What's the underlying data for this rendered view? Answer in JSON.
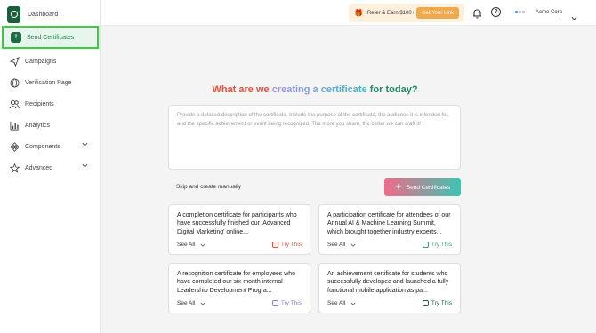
{
  "sidebar": {
    "brand_label": "Dashboard",
    "items": [
      {
        "label": "Send Certificates",
        "icon": "plus-icon",
        "active": true
      },
      {
        "label": "Campaigns",
        "icon": "send-icon"
      },
      {
        "label": "Verification Page",
        "icon": "globe-icon"
      },
      {
        "label": "Recipients",
        "icon": "users-icon"
      },
      {
        "label": "Analytics",
        "icon": "bar-chart-icon"
      },
      {
        "label": "Components",
        "icon": "components-icon",
        "expandable": true
      },
      {
        "label": "Advanced",
        "icon": "star-icon",
        "expandable": true
      }
    ]
  },
  "topbar": {
    "refer_label": "Refer & Earn $100+",
    "get_link_label": "Get Your Link",
    "account_name": "Acme Corp"
  },
  "main": {
    "headline": {
      "part1": "What are we ",
      "highlight": "creating a certificate",
      "part2": " for today?"
    },
    "prompt_placeholder": "Provide a detailed description of the certificate. Include the purpose of the certificate, the audience it is intended for, and the specific achievement or event being recognized. The more you share, the better we can craft it!",
    "skip_label": "Skip and create manually",
    "send_label": "Send Certificates",
    "cards": [
      {
        "text": "A completion certificate for participants who have successfully finished our 'Advanced Digital Marketing' online...",
        "see_all": "See All",
        "try_label": "Try This",
        "color": "#e0533d"
      },
      {
        "text": "A participation certificate for attendees of our Annual AI & Machine Learning Summit, which brought together industry experts...",
        "see_all": "See All",
        "try_label": "Try This",
        "color": "#3aa86b"
      },
      {
        "text": "A recognition certificate for employees who have completed our six-month internal Leadership Development Progra...",
        "see_all": "See All",
        "try_label": "Try This",
        "color": "#8a7fe0"
      },
      {
        "text": "An achievement certificate for students who successfully developed and launched a fully functional mobile application as pa...",
        "see_all": "See All",
        "try_label": "Try This",
        "color": "#1c6b46"
      }
    ]
  },
  "colors": {
    "brand_green": "#1d6b46",
    "active_border": "#3ccd3c",
    "refer_bg": "#fdf0dc",
    "get_link_bg": "#f0a94a"
  }
}
